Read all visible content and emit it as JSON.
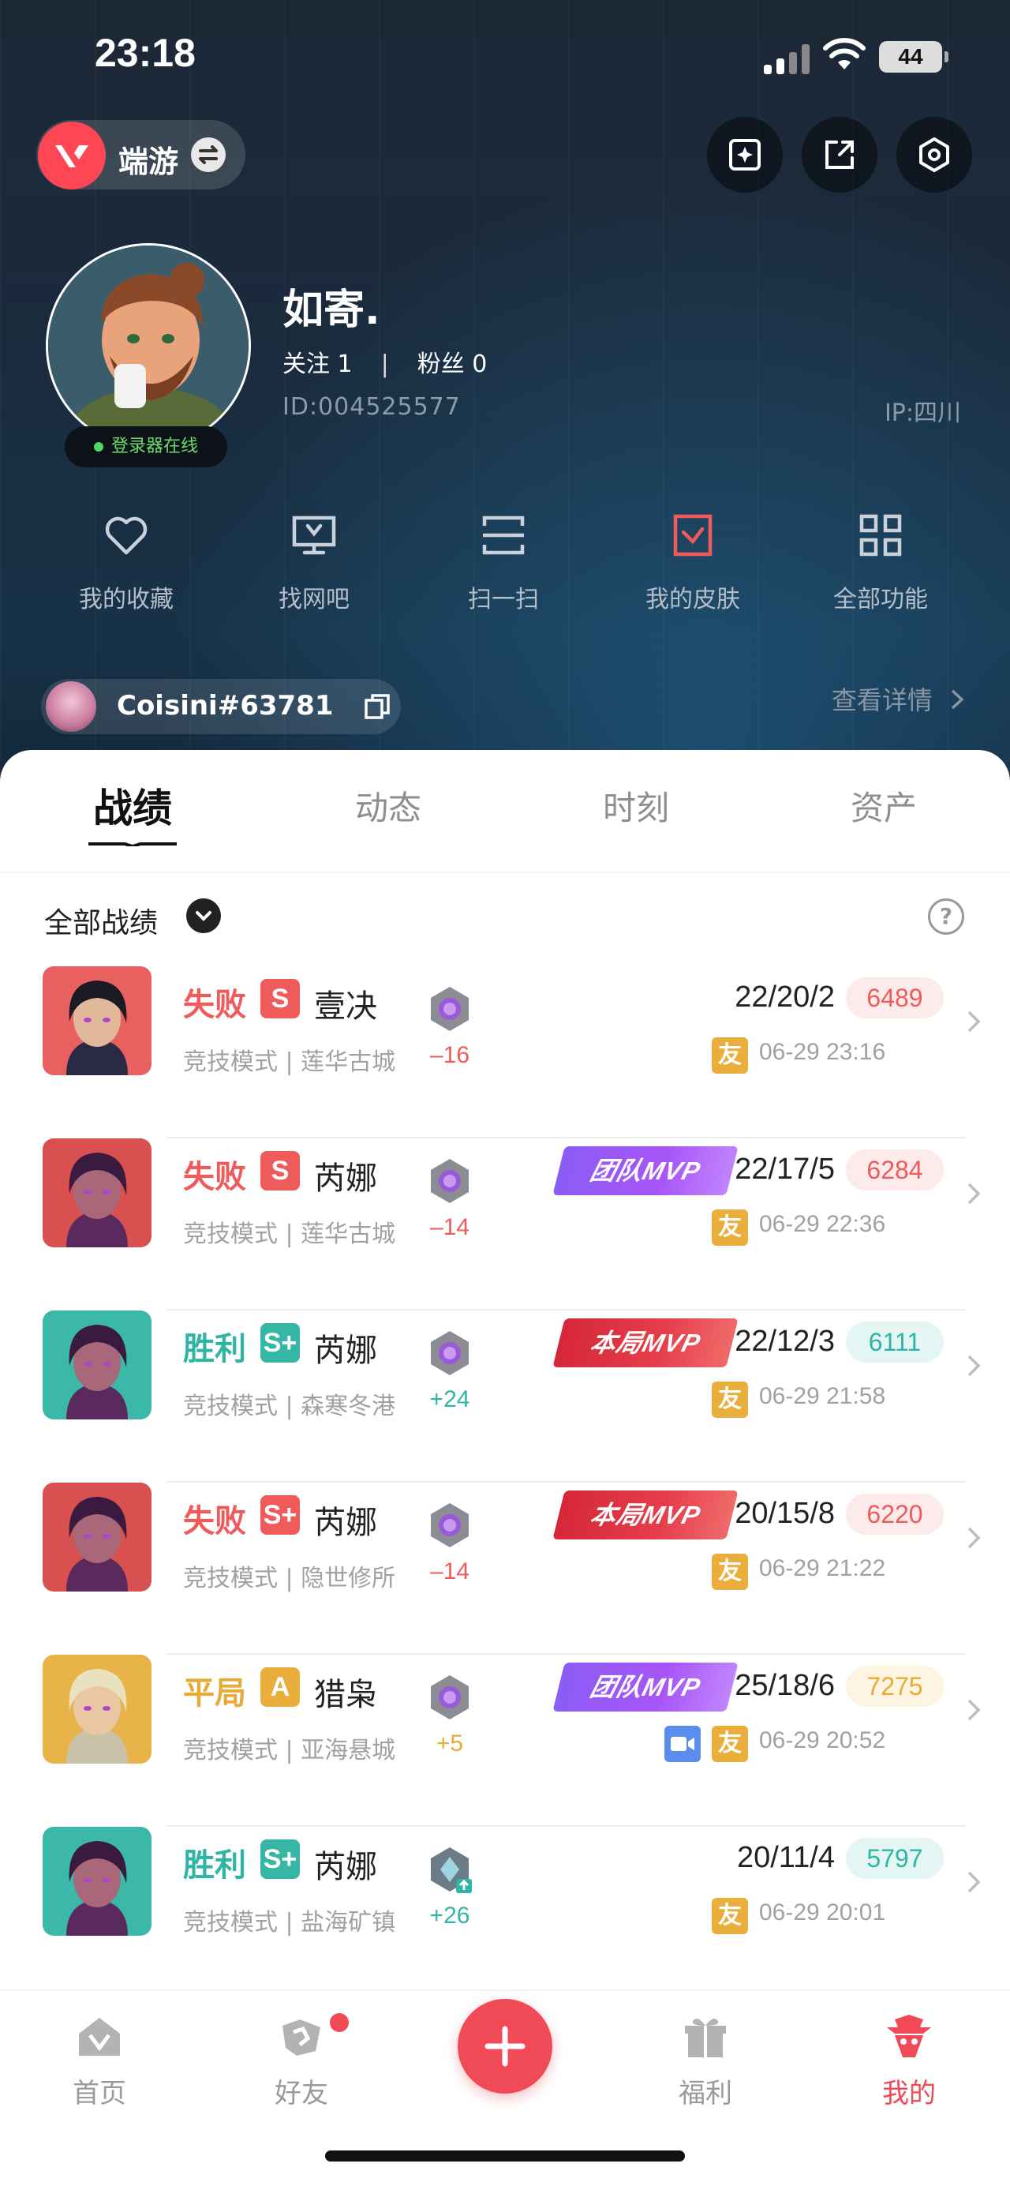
{
  "status_bar": {
    "time": "23:18",
    "battery": "44"
  },
  "header": {
    "app_name": "端游",
    "nickname": "如寄.",
    "follow_label": "关注 1",
    "fans_label": "粉丝 0",
    "separator": "|",
    "user_id": "ID:004525577",
    "ip": "IP:四川",
    "online_status": "登录器在线"
  },
  "functions": [
    {
      "label": "我的收藏",
      "icon": "heart-icon"
    },
    {
      "label": "找网吧",
      "icon": "monitor-icon"
    },
    {
      "label": "扫一扫",
      "icon": "scan-icon"
    },
    {
      "label": "我的皮肤",
      "icon": "skin-icon"
    },
    {
      "label": "全部功能",
      "icon": "grid-icon"
    }
  ],
  "game_account": {
    "name": "Coisini#63781",
    "detail_link": "查看详情"
  },
  "tabs": [
    {
      "label": "战绩",
      "active": true
    },
    {
      "label": "动态",
      "active": false
    },
    {
      "label": "时刻",
      "active": false
    },
    {
      "label": "资产",
      "active": false
    }
  ],
  "filter": {
    "label": "全部战绩"
  },
  "matches": [
    {
      "result": "失败",
      "grade": "S",
      "agent": "壹决",
      "mode": "竞技模式 | 莲华古城",
      "delta": "–16",
      "mvp": "",
      "kda": "22/20/2",
      "score": "6489",
      "friend": "友",
      "video": false,
      "time": "06-29 23:16"
    },
    {
      "result": "失败",
      "grade": "S",
      "agent": "芮娜",
      "mode": "竞技模式 | 莲华古城",
      "delta": "–14",
      "mvp": "团队MVP",
      "kda": "22/17/5",
      "score": "6284",
      "friend": "友",
      "video": false,
      "time": "06-29 22:36"
    },
    {
      "result": "胜利",
      "grade": "S+",
      "agent": "芮娜",
      "mode": "竞技模式 | 森寒冬港",
      "delta": "+24",
      "mvp": "本局MVP",
      "kda": "22/12/3",
      "score": "6111",
      "friend": "友",
      "video": false,
      "time": "06-29 21:58"
    },
    {
      "result": "失败",
      "grade": "S+",
      "agent": "芮娜",
      "mode": "竞技模式 | 隐世修所",
      "delta": "–14",
      "mvp": "本局MVP",
      "kda": "20/15/8",
      "score": "6220",
      "friend": "友",
      "video": false,
      "time": "06-29 21:22"
    },
    {
      "result": "平局",
      "grade": "A",
      "agent": "猎枭",
      "mode": "竞技模式 | 亚海悬城",
      "delta": "+5",
      "mvp": "团队MVP",
      "kda": "25/18/6",
      "score": "7275",
      "friend": "友",
      "video": true,
      "time": "06-29 20:52"
    },
    {
      "result": "胜利",
      "grade": "S+",
      "agent": "芮娜",
      "mode": "竞技模式 | 盐海矿镇",
      "delta": "+26",
      "mvp": "",
      "kda": "20/11/4",
      "score": "5797",
      "friend": "友",
      "video": false,
      "time": "06-29 20:01"
    }
  ],
  "bottom_nav": [
    {
      "label": "首页",
      "active": false
    },
    {
      "label": "好友",
      "active": false
    },
    {
      "label": "福利",
      "active": false
    },
    {
      "label": "我的",
      "active": true
    }
  ],
  "colors": {
    "accent": "#ef4a55",
    "win": "#2fb5a5",
    "lose": "#ef5a5a",
    "draw": "#e6ac3a"
  }
}
